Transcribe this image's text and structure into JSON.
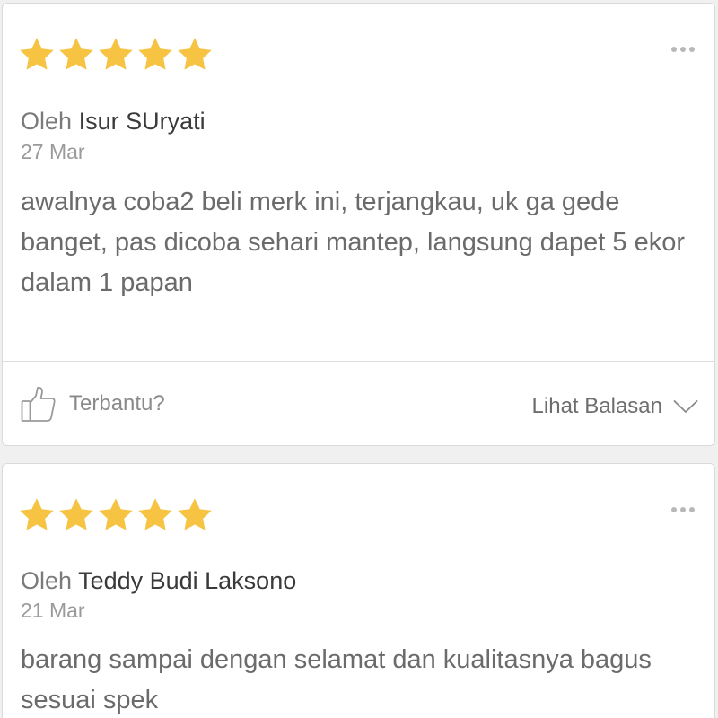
{
  "reviews": [
    {
      "rating": 5,
      "by_label": "Oleh",
      "author": "Isur SUryati",
      "date": "27 Mar",
      "text": "awalnya coba2 beli merk ini, terjangkau, uk ga gede banget, pas dicoba sehari mantep, langsung dapet 5 ekor dalam 1 papan",
      "helpful_label": "Terbantu?",
      "replies_label": "Lihat Balasan"
    },
    {
      "rating": 5,
      "by_label": "Oleh",
      "author": "Teddy Budi Laksono",
      "date": "21 Mar",
      "text": "barang sampai dengan selamat dan kualitasnya bagus sesuai spek"
    }
  ],
  "colors": {
    "star": "#f6c342",
    "background": "#f0f0f0",
    "card": "#ffffff"
  },
  "icons": {
    "star": "star-icon",
    "more": "more-dots-icon",
    "helpful": "thumbs-up-icon",
    "expand": "chevron-down-icon"
  }
}
